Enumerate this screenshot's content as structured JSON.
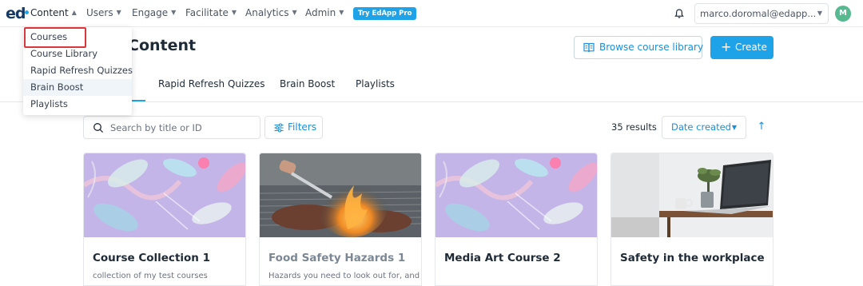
{
  "brand": {
    "logo_text": "ed"
  },
  "nav": {
    "items": [
      {
        "label": "Content"
      },
      {
        "label": "Users"
      },
      {
        "label": "Engage"
      },
      {
        "label": "Facilitate"
      },
      {
        "label": "Analytics"
      },
      {
        "label": "Admin"
      }
    ],
    "try_pro": "Try EdApp Pro",
    "user_email": "marco.doromal@edapp...",
    "avatar_initial": "M"
  },
  "content_menu": {
    "items": [
      {
        "label": "Courses"
      },
      {
        "label": "Course Library"
      },
      {
        "label": "Rapid Refresh Quizzes"
      },
      {
        "label": "Brain Boost"
      },
      {
        "label": "Playlists"
      }
    ]
  },
  "page": {
    "title": "Content",
    "browse_label": "Browse course library",
    "create_label": "Create"
  },
  "tabs": [
    {
      "label": "Rapid Refresh Quizzes"
    },
    {
      "label": "Brain Boost"
    },
    {
      "label": "Playlists"
    }
  ],
  "toolbar": {
    "search_placeholder": "Search by title or ID",
    "filters_label": "Filters",
    "results_text": "35 results",
    "sort_label": "Date created"
  },
  "cards": [
    {
      "title": "Course Collection 1",
      "description": "collection of my test courses",
      "thumb": "abstract-pattern"
    },
    {
      "title": "Food Safety Hazards 1",
      "description": "Hazards you need to look out for, and",
      "thumb": "grill-photo"
    },
    {
      "title": "Media Art Course 2",
      "description": "",
      "thumb": "abstract-pattern"
    },
    {
      "title": "Safety in the workplace",
      "description": "",
      "thumb": "desk-photo"
    }
  ],
  "colors": {
    "accent": "#1fa3e8",
    "highlight_box": "#d9363e",
    "avatar": "#56b98f"
  }
}
